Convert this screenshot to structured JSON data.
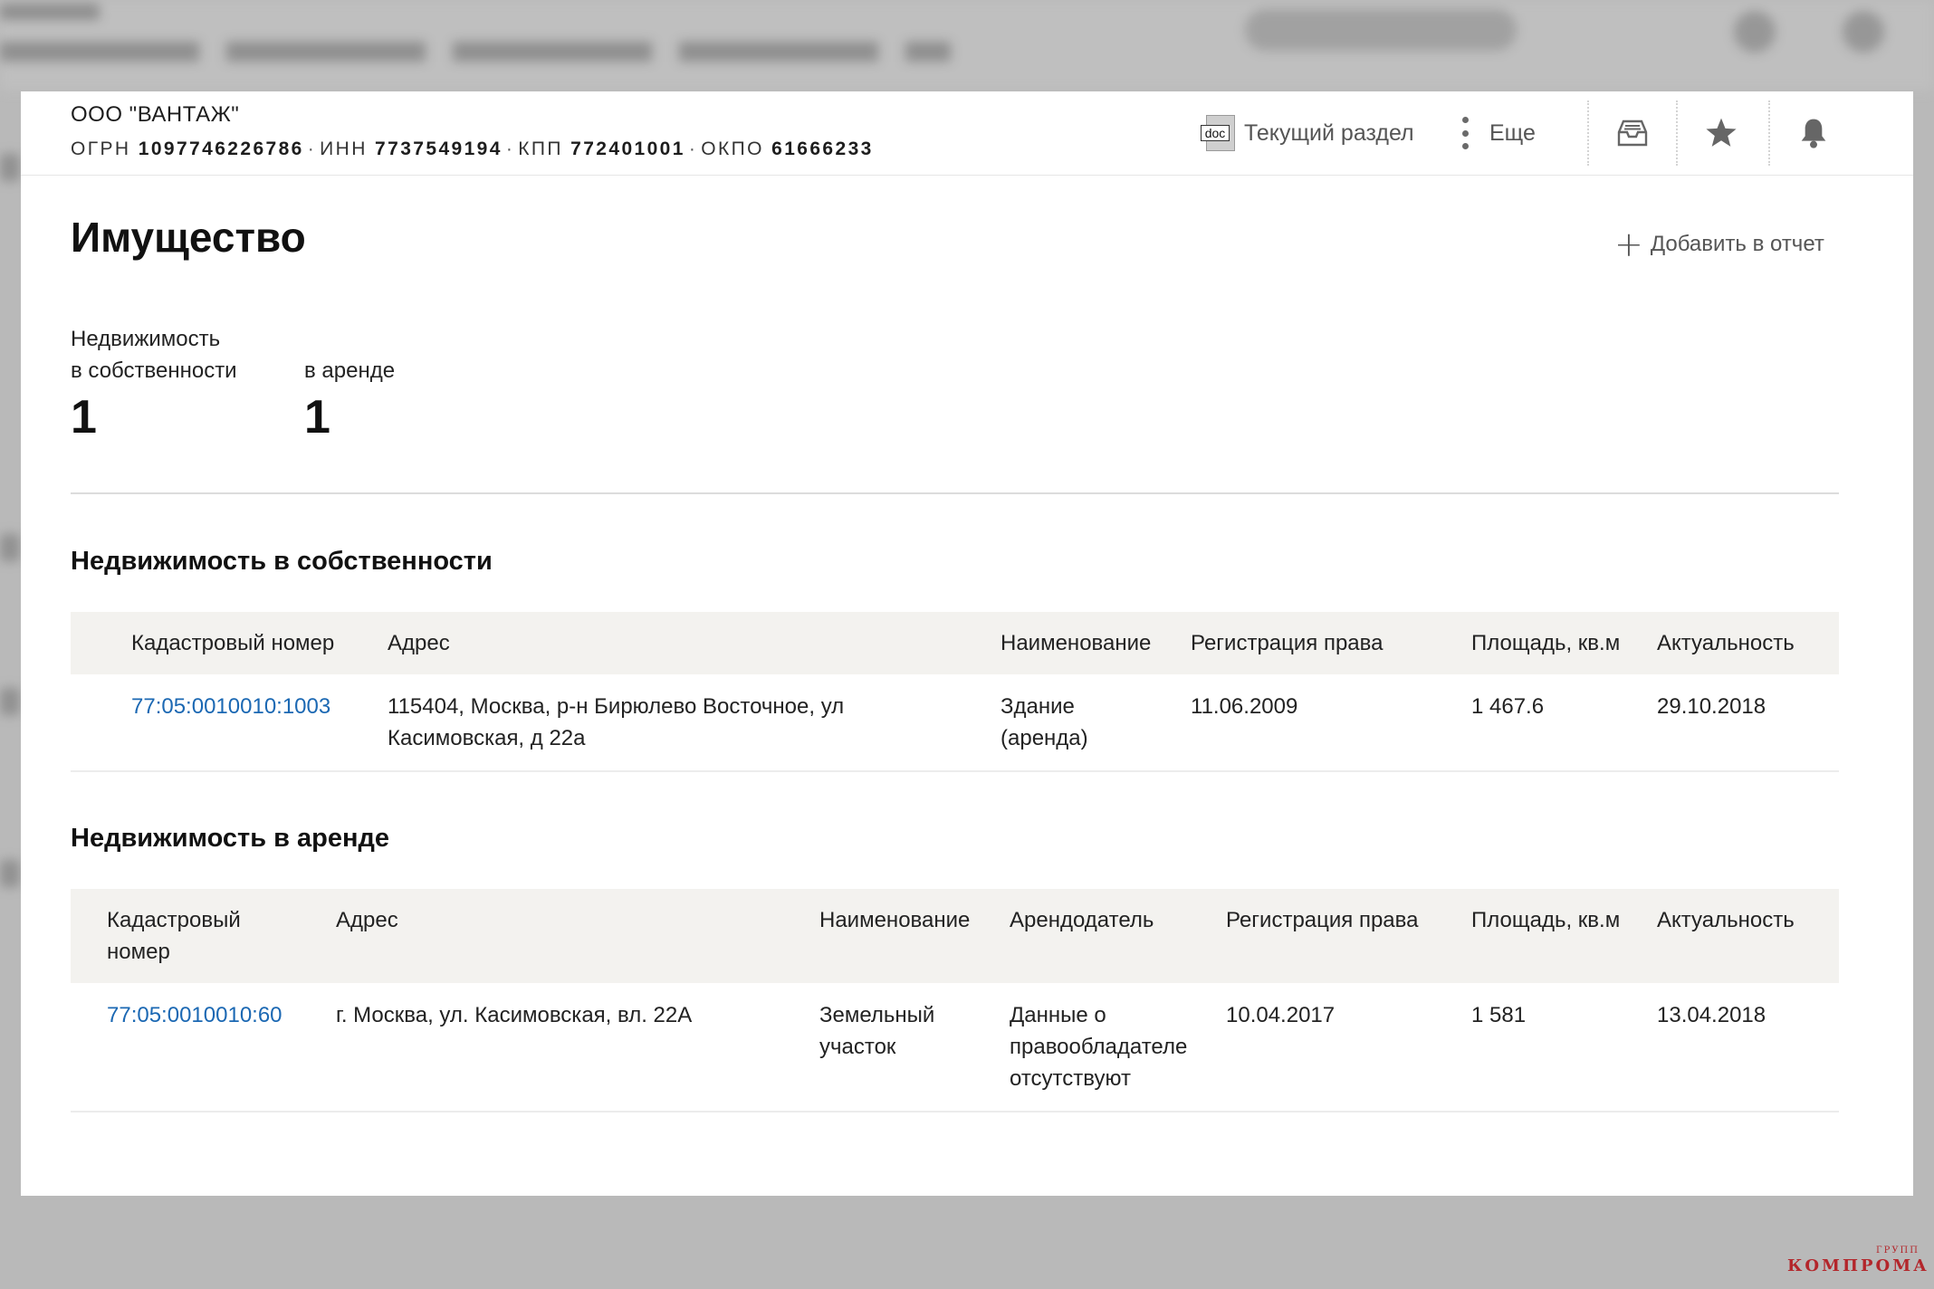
{
  "company": {
    "name": "ООО \"ВАНТАЖ\"",
    "ids": [
      {
        "label": "ОГРН",
        "value": "1097746226786"
      },
      {
        "label": "ИНН",
        "value": "7737549194"
      },
      {
        "label": "КПП",
        "value": "772401001"
      },
      {
        "label": "ОКПО",
        "value": "61666233"
      }
    ]
  },
  "header_actions": {
    "current_section": "Текущий раздел",
    "current_section_icon_text": "doc",
    "more": "Еще"
  },
  "icons": {
    "inbox": "inbox-tray-icon",
    "star": "star-icon",
    "bell": "bell-icon",
    "plus": "plus-icon",
    "more": "kebab-menu-icon",
    "doc": "doc-file-icon"
  },
  "page": {
    "title": "Имущество",
    "add_to_report": "Добавить в отчет"
  },
  "stats": [
    {
      "label": "Недвижимость\nв собственности",
      "value": "1"
    },
    {
      "label": "в аренде",
      "value": "1"
    }
  ],
  "owned": {
    "title": "Недвижимость в собственности",
    "columns": [
      "Кадастровый номер",
      "Адрес",
      "Наименование",
      "Регистрация права",
      "Площадь, кв.м",
      "Актуальность"
    ],
    "rows": [
      {
        "cadastral": "77:05:0010010:1003",
        "address": "115404, Москва, р-н Бирюлево Восточное, ул\nКасимовская, д 22а",
        "name": "Здание\n(аренда)",
        "registration": "11.06.2009",
        "area": "1 467.6",
        "actuality": "29.10.2018"
      }
    ]
  },
  "leased": {
    "title": "Недвижимость в аренде",
    "columns": [
      "Кадастровый\nномер",
      "Адрес",
      "Наименование",
      "Арендодатель",
      "Регистрация права",
      "Площадь, кв.м",
      "Актуальность"
    ],
    "rows": [
      {
        "cadastral": "77:05:0010010:60",
        "address": "г. Москва, ул. Касимовская, вл. 22А",
        "name": "Земельный\nучасток",
        "lessor": "Данные о\nправообладателе\nотсутствуют",
        "registration": "10.04.2017",
        "area": "1 581",
        "actuality": "13.04.2018"
      }
    ]
  },
  "colors": {
    "link": "#1b68b3",
    "table_header_bg": "#f3f2ef",
    "overlay_bg": "#b9b9b9",
    "watermark": "#b3262b"
  },
  "watermark": {
    "main": "КОМПРОМАТ",
    "small": "ГРУПП"
  }
}
